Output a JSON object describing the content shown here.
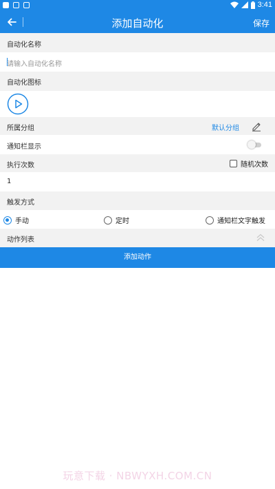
{
  "status_bar": {
    "time": "3:41"
  },
  "app_bar": {
    "title": "添加自动化",
    "save_label": "保存"
  },
  "form": {
    "name_label": "自动化名称",
    "name_placeholder": "请输入自动化名称",
    "icon_label": "自动化图标",
    "group_label": "所属分组",
    "group_value": "默认分组",
    "notification_label": "通知栏显示",
    "notification_enabled": false,
    "exec_count_label": "执行次数",
    "random_count_label": "随机次数",
    "random_count_checked": false,
    "exec_count_value": "1",
    "trigger_label": "触发方式",
    "trigger_options": [
      {
        "label": "手动",
        "checked": true
      },
      {
        "label": "定时",
        "checked": false
      },
      {
        "label": "通知栏文字触发",
        "checked": false
      }
    ],
    "action_list_label": "动作列表",
    "add_action_label": "添加动作"
  },
  "watermark": "玩意下载 · NBWYXH.COM.CN",
  "colors": {
    "primary": "#1e88e5",
    "section_bg": "#f2f2f2"
  }
}
